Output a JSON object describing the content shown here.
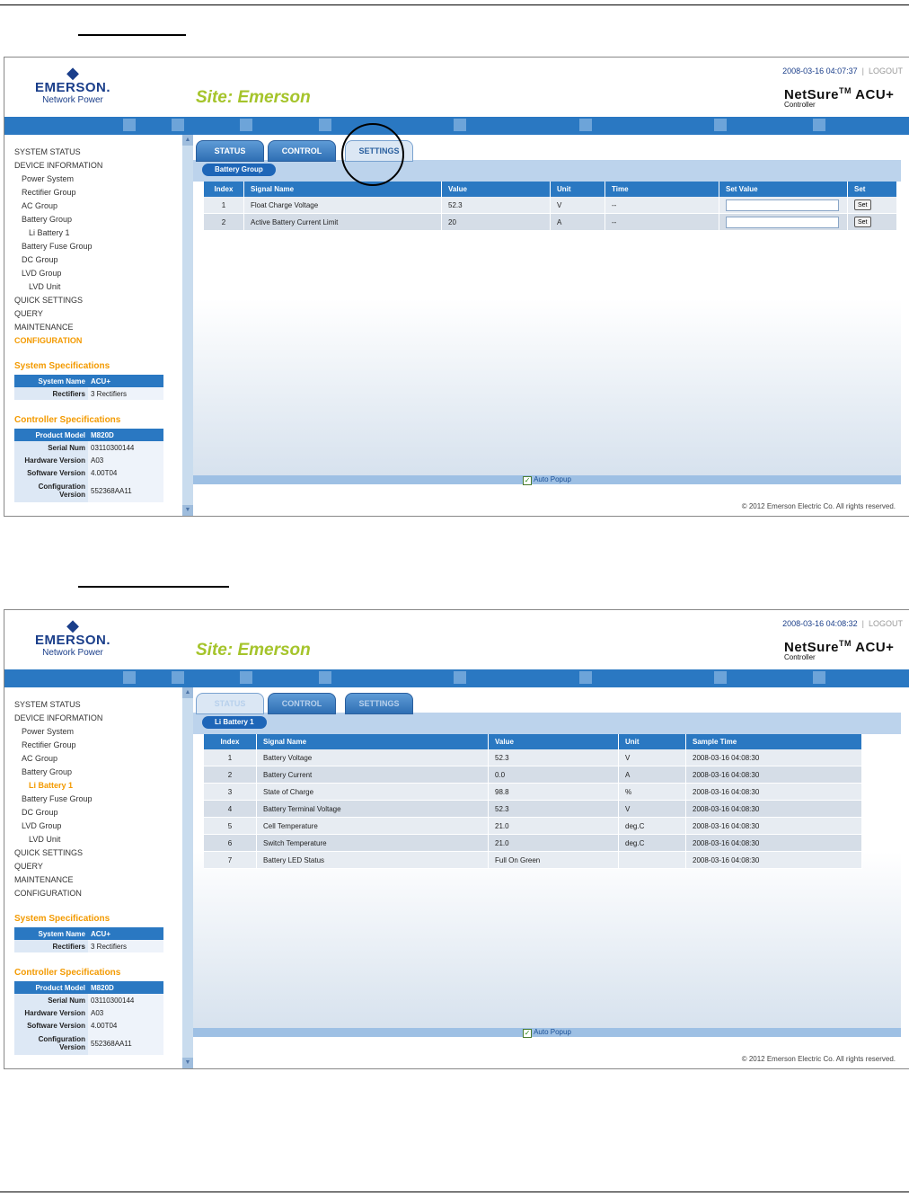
{
  "screen1": {
    "datetime": "2008-03-16 04:07:37",
    "logout": "LOGOUT",
    "logo": {
      "brand": "EMERSON.",
      "sub": "Network Power"
    },
    "site": "Site: Emerson",
    "product": {
      "name": "NetSure",
      "tm": "TM",
      "suffix": "ACU+",
      "sub": "Controller"
    },
    "nav": [
      {
        "label": "SYSTEM STATUS"
      },
      {
        "label": "DEVICE INFORMATION"
      },
      {
        "label": "Power System"
      },
      {
        "label": "Rectifier Group"
      },
      {
        "label": "AC Group"
      },
      {
        "label": "Battery Group"
      },
      {
        "label": "Li Battery 1"
      },
      {
        "label": "Battery Fuse Group"
      },
      {
        "label": "DC Group"
      },
      {
        "label": "LVD Group"
      },
      {
        "label": "LVD Unit"
      },
      {
        "label": "QUICK SETTINGS"
      },
      {
        "label": "QUERY"
      },
      {
        "label": "MAINTENANCE"
      },
      {
        "label": "CONFIGURATION"
      }
    ],
    "sys_spec": {
      "title": "System Specifications",
      "rows": [
        [
          "System Name",
          "ACU+"
        ],
        [
          "Rectifiers",
          "3 Rectifiers"
        ]
      ]
    },
    "ctl_spec": {
      "title": "Controller Specifications",
      "rows": [
        [
          "Product Model",
          "M820D"
        ],
        [
          "Serial Num",
          "03110300144"
        ],
        [
          "Hardware Version",
          "A03"
        ],
        [
          "Software Version",
          "4.00T04"
        ],
        [
          "Configuration Version",
          "552368AA11"
        ]
      ]
    },
    "tabs": [
      "STATUS",
      "CONTROL",
      "SETTINGS"
    ],
    "group_pill": "Battery Group",
    "table": {
      "headers": [
        "Index",
        "Signal Name",
        "Value",
        "Unit",
        "Time",
        "Set Value",
        "Set"
      ],
      "rows": [
        {
          "index": "1",
          "name": "Float Charge Voltage",
          "value": "52.3",
          "unit": "V",
          "time": "--",
          "set": "Set"
        },
        {
          "index": "2",
          "name": "Active Battery Current Limit",
          "value": "20",
          "unit": "A",
          "time": "--",
          "set": "Set"
        }
      ]
    },
    "auto_popup": "Auto Popup",
    "check": "✓",
    "copyright": "© 2012 Emerson Electric Co. All rights reserved."
  },
  "screen2": {
    "datetime": "2008-03-16 04:08:32",
    "logout": "LOGOUT",
    "logo": {
      "brand": "EMERSON.",
      "sub": "Network Power"
    },
    "site": "Site: Emerson",
    "product": {
      "name": "NetSure",
      "tm": "TM",
      "suffix": "ACU+",
      "sub": "Controller"
    },
    "nav": [
      {
        "label": "SYSTEM STATUS"
      },
      {
        "label": "DEVICE INFORMATION"
      },
      {
        "label": "Power System"
      },
      {
        "label": "Rectifier Group"
      },
      {
        "label": "AC Group"
      },
      {
        "label": "Battery Group"
      },
      {
        "label": "Li Battery 1"
      },
      {
        "label": "Battery Fuse Group"
      },
      {
        "label": "DC Group"
      },
      {
        "label": "LVD Group"
      },
      {
        "label": "LVD Unit"
      },
      {
        "label": "QUICK SETTINGS"
      },
      {
        "label": "QUERY"
      },
      {
        "label": "MAINTENANCE"
      },
      {
        "label": "CONFIGURATION"
      }
    ],
    "sys_spec": {
      "title": "System Specifications",
      "rows": [
        [
          "System Name",
          "ACU+"
        ],
        [
          "Rectifiers",
          "3 Rectifiers"
        ]
      ]
    },
    "ctl_spec": {
      "title": "Controller Specifications",
      "rows": [
        [
          "Product Model",
          "M820D"
        ],
        [
          "Serial Num",
          "03110300144"
        ],
        [
          "Hardware Version",
          "A03"
        ],
        [
          "Software Version",
          "4.00T04"
        ],
        [
          "Configuration Version",
          "552368AA11"
        ]
      ]
    },
    "tabs": [
      "STATUS",
      "CONTROL",
      "SETTINGS"
    ],
    "group_pill": "Li Battery 1",
    "table": {
      "headers": [
        "Index",
        "Signal Name",
        "Value",
        "Unit",
        "Sample Time"
      ],
      "rows": [
        {
          "index": "1",
          "name": "Battery Voltage",
          "value": "52.3",
          "unit": "V",
          "time": "2008-03-16 04:08:30"
        },
        {
          "index": "2",
          "name": "Battery Current",
          "value": "0.0",
          "unit": "A",
          "time": "2008-03-16 04:08:30"
        },
        {
          "index": "3",
          "name": "State of Charge",
          "value": "98.8",
          "unit": "%",
          "time": "2008-03-16 04:08:30"
        },
        {
          "index": "4",
          "name": "Battery Terminal Voltage",
          "value": "52.3",
          "unit": "V",
          "time": "2008-03-16 04:08:30"
        },
        {
          "index": "5",
          "name": "Cell Temperature",
          "value": "21.0",
          "unit": "deg.C",
          "time": "2008-03-16 04:08:30"
        },
        {
          "index": "6",
          "name": "Switch Temperature",
          "value": "21.0",
          "unit": "deg.C",
          "time": "2008-03-16 04:08:30"
        },
        {
          "index": "7",
          "name": "Battery LED Status",
          "value": "Full On Green",
          "unit": "",
          "time": "2008-03-16 04:08:30"
        }
      ]
    },
    "auto_popup": "Auto Popup",
    "check": "✓",
    "copyright": "© 2012 Emerson Electric Co. All rights reserved."
  },
  "colors": {
    "accent": "#2a78c2",
    "site_green": "#a5c42b",
    "active_orange": "#f39a00"
  }
}
